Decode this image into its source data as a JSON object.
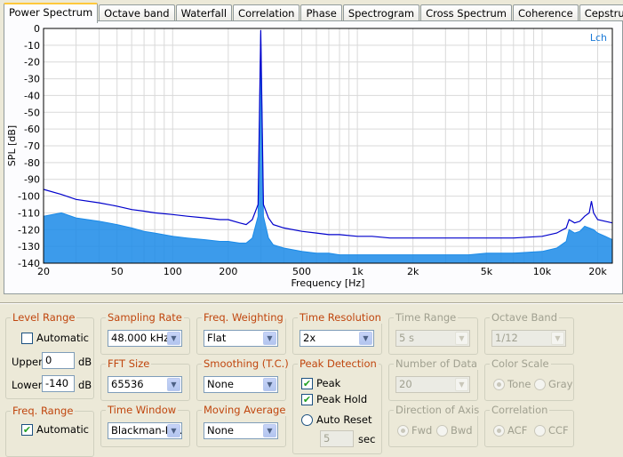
{
  "tabs": [
    "Power Spectrum",
    "Octave band",
    "Waterfall",
    "Correlation",
    "Phase",
    "Spectrogram",
    "Cross Spectrum",
    "Coherence",
    "Cepstrum"
  ],
  "active_tab": 0,
  "chart_data": {
    "type": "line",
    "xlabel": "Frequency [Hz]",
    "ylabel": "SPL [dB]",
    "xscale": "log",
    "xlim": [
      20,
      24000
    ],
    "ylim": [
      -140,
      0
    ],
    "y_ticks": [
      "0",
      "-10",
      "-20",
      "-30",
      "-40",
      "-50",
      "-60",
      "-70",
      "-80",
      "-90",
      "-100",
      "-110",
      "-120",
      "-130",
      "-140"
    ],
    "x_ticks": [
      "20",
      "50",
      "100",
      "200",
      "500",
      "1k",
      "2k",
      "5k",
      "10k",
      "20k"
    ],
    "grid": true,
    "channel_label": "Lch",
    "colors": {
      "peak_hold": "#0000cc",
      "spectrum": "#1a8ae8",
      "channel_label": "#1a7ad8"
    },
    "series": [
      {
        "x": [
          20,
          25,
          30,
          40,
          50,
          60,
          70,
          80,
          100,
          120,
          150,
          180,
          200,
          230,
          250,
          270,
          290,
          300,
          310,
          330,
          350,
          400,
          500,
          600,
          700,
          800,
          1000,
          1200,
          1500,
          2000,
          3000,
          4000,
          5000,
          7000,
          10000,
          12000,
          13500,
          14000,
          15000,
          16000,
          17000,
          18000,
          18500,
          19000,
          20000,
          22000,
          24000
        ],
        "y": [
          -96,
          -99,
          -102,
          -104,
          -106,
          -108,
          -109,
          -110,
          -111,
          -112,
          -113,
          -114,
          -114,
          -116,
          -117,
          -114,
          -105,
          -1,
          -105,
          -113,
          -117,
          -119,
          -121,
          -122,
          -123,
          -123,
          -124,
          -124,
          -125,
          -125,
          -125,
          -125,
          -125,
          -125,
          -124,
          -122,
          -119,
          -114,
          -116,
          -115,
          -112,
          -110,
          -103,
          -110,
          -114,
          -115,
          -116
        ]
      },
      {
        "x": [
          20,
          25,
          30,
          40,
          50,
          60,
          70,
          80,
          100,
          120,
          150,
          180,
          200,
          230,
          250,
          270,
          290,
          300,
          310,
          330,
          350,
          400,
          500,
          600,
          700,
          800,
          1000,
          1200,
          1500,
          2000,
          3000,
          4000,
          5000,
          7000,
          10000,
          12000,
          13500,
          14000,
          15000,
          16000,
          17000,
          18000,
          19000,
          20000,
          22000,
          24000
        ],
        "y": [
          -112,
          -110,
          -113,
          -115,
          -117,
          -119,
          -121,
          -122,
          -124,
          -125,
          -126,
          -127,
          -127,
          -128,
          -128,
          -125,
          -112,
          -3,
          -112,
          -125,
          -129,
          -131,
          -133,
          -134,
          -134,
          -135,
          -135,
          -135,
          -135,
          -135,
          -135,
          -135,
          -134,
          -134,
          -133,
          -131,
          -127,
          -120,
          -122,
          -121,
          -118,
          -119,
          -120,
          -122,
          -124,
          -126
        ]
      }
    ]
  },
  "level_range": {
    "title": "Level Range",
    "automatic": "Automatic",
    "upper_label": "Upper",
    "upper_value": "0",
    "lower_label": "Lower",
    "lower_value": "-140",
    "unit": "dB"
  },
  "freq_range": {
    "title": "Freq. Range",
    "automatic": "Automatic"
  },
  "sampling_rate": {
    "title": "Sampling Rate",
    "value": "48.000 kHz"
  },
  "fft_size": {
    "title": "FFT Size",
    "value": "65536"
  },
  "time_window": {
    "title": "Time Window",
    "value": "Blackman-H..."
  },
  "freq_weighting": {
    "title": "Freq. Weighting",
    "value": "Flat"
  },
  "smoothing": {
    "title": "Smoothing (T.C.)",
    "value": "None"
  },
  "moving_average": {
    "title": "Moving Average",
    "value": "None"
  },
  "time_resolution": {
    "title": "Time Resolution",
    "value": "2x"
  },
  "peak_detection": {
    "title": "Peak Detection",
    "peak": "Peak",
    "peak_hold": "Peak Hold",
    "auto_reset": "Auto Reset",
    "reset_value": "5",
    "unit": "sec"
  },
  "time_range": {
    "title": "Time Range",
    "value": "5 s"
  },
  "number_of_data": {
    "title": "Number of Data",
    "value": "20"
  },
  "direction_of_axis": {
    "title": "Direction of Axis",
    "fwd": "Fwd",
    "bwd": "Bwd"
  },
  "octave_band": {
    "title": "Octave Band",
    "value": "1/12"
  },
  "color_scale": {
    "title": "Color Scale",
    "tone": "Tone",
    "gray": "Gray"
  },
  "correlation": {
    "title": "Correlation",
    "acf": "ACF",
    "ccf": "CCF"
  }
}
